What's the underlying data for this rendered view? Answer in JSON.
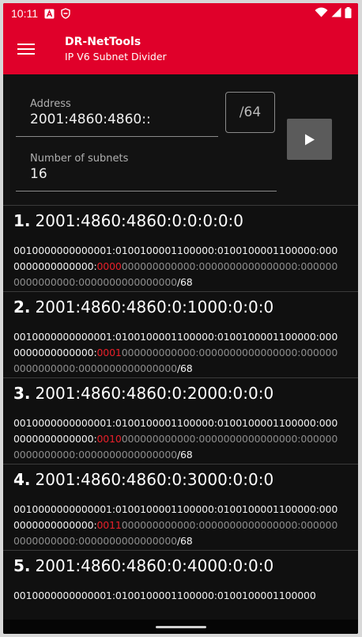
{
  "status_bar": {
    "time": "10:11",
    "icons": [
      "notification-a-icon",
      "vpn-shield-icon",
      "wifi-icon",
      "signal-icon",
      "battery-icon"
    ]
  },
  "app_bar": {
    "title": "DR-NetTools",
    "subtitle": "IP V6 Subnet Divider",
    "menu_icon": "hamburger-menu-icon",
    "color": "#e0002a"
  },
  "form": {
    "address_label": "Address",
    "address_value": "2001:4860:4860::",
    "prefix_value": "/64",
    "subnets_label": "Number of subnets",
    "subnets_value": "16",
    "run_icon": "play-icon"
  },
  "colors": {
    "background": "#101010",
    "network_bits": "#f2f2f2",
    "subnet_bits": "#e8202a",
    "host_bits": "#8d8d8d"
  },
  "results": [
    {
      "index": "1.",
      "address": "2001:4860:4860:0:0:0:0:0",
      "network_bits": "0010000000000001:0100100001100000:0100100001100000:0000000000000000:",
      "subnet_bits": "0000",
      "host_bits": "000000000000:0000000000000000:0000000000000000:0000000000000000",
      "prefix": "/68"
    },
    {
      "index": "2.",
      "address": "2001:4860:4860:0:1000:0:0:0",
      "network_bits": "0010000000000001:0100100001100000:0100100001100000:0000000000000000:",
      "subnet_bits": "0001",
      "host_bits": "000000000000:0000000000000000:0000000000000000:0000000000000000",
      "prefix": "/68"
    },
    {
      "index": "3.",
      "address": "2001:4860:4860:0:2000:0:0:0",
      "network_bits": "0010000000000001:0100100001100000:0100100001100000:0000000000000000:",
      "subnet_bits": "0010",
      "host_bits": "000000000000:0000000000000000:0000000000000000:0000000000000000",
      "prefix": "/68"
    },
    {
      "index": "4.",
      "address": "2001:4860:4860:0:3000:0:0:0",
      "network_bits": "0010000000000001:0100100001100000:0100100001100000:0000000000000000:",
      "subnet_bits": "0011",
      "host_bits": "000000000000:0000000000000000:0000000000000000:0000000000000000",
      "prefix": "/68"
    },
    {
      "index": "5.",
      "address": "2001:4860:4860:0:4000:0:0:0",
      "network_bits": "0010000000000001:0100100001100000:0100100001100000",
      "subnet_bits": "",
      "host_bits": "",
      "prefix": ""
    }
  ]
}
